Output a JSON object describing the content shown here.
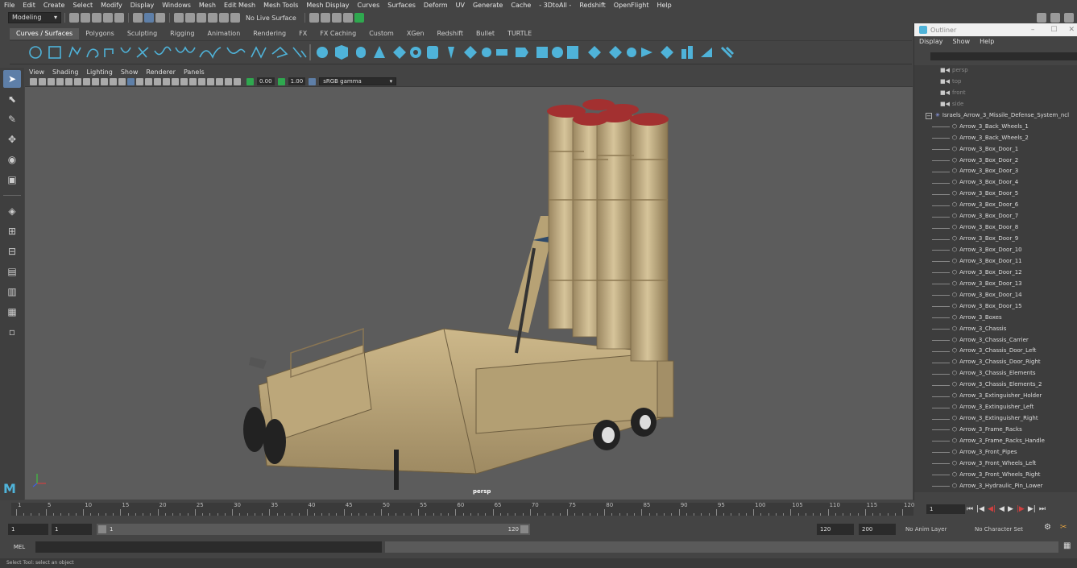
{
  "menubar": [
    "File",
    "Edit",
    "Create",
    "Select",
    "Modify",
    "Display",
    "Windows",
    "Mesh",
    "Edit Mesh",
    "Mesh Tools",
    "Mesh Display",
    "Curves",
    "Surfaces",
    "Deform",
    "UV",
    "Generate",
    "Cache",
    "- 3DtoAll -",
    "Redshift",
    "OpenFlight",
    "Help"
  ],
  "status": {
    "mode": "Modeling",
    "live_surface": "No Live Surface"
  },
  "shelf_tabs": [
    "Curves / Surfaces",
    "Polygons",
    "Sculpting",
    "Rigging",
    "Animation",
    "Rendering",
    "FX",
    "FX Caching",
    "Custom",
    "XGen",
    "Redshift",
    "Bullet",
    "TURTLE"
  ],
  "shelf_active": "Curves / Surfaces",
  "viewport": {
    "menu": [
      "View",
      "Shading",
      "Lighting",
      "Show",
      "Renderer",
      "Panels"
    ],
    "exposure": "0.00",
    "gamma": "1.00",
    "colorspace": "sRGB gamma",
    "camera": "persp"
  },
  "outliner": {
    "title": "Outliner",
    "menu": [
      "Display",
      "Show",
      "Help"
    ],
    "cameras": [
      "persp",
      "top",
      "front",
      "side"
    ],
    "root": "Israels_Arrow_3_Missile_Defense_System_ncl",
    "items": [
      "Arrow_3_Back_Wheels_1",
      "Arrow_3_Back_Wheels_2",
      "Arrow_3_Box_Door_1",
      "Arrow_3_Box_Door_2",
      "Arrow_3_Box_Door_3",
      "Arrow_3_Box_Door_4",
      "Arrow_3_Box_Door_5",
      "Arrow_3_Box_Door_6",
      "Arrow_3_Box_Door_7",
      "Arrow_3_Box_Door_8",
      "Arrow_3_Box_Door_9",
      "Arrow_3_Box_Door_10",
      "Arrow_3_Box_Door_11",
      "Arrow_3_Box_Door_12",
      "Arrow_3_Box_Door_13",
      "Arrow_3_Box_Door_14",
      "Arrow_3_Box_Door_15",
      "Arrow_3_Boxes",
      "Arrow_3_Chassis",
      "Arrow_3_Chassis_Carrier",
      "Arrow_3_Chassis_Door_Left",
      "Arrow_3_Chassis_Door_Right",
      "Arrow_3_Chassis_Elements",
      "Arrow_3_Chassis_Elements_2",
      "Arrow_3_Extinguisher_Holder",
      "Arrow_3_Extinguisher_Left",
      "Arrow_3_Extinguisher_Right",
      "Arrow_3_Frame_Racks",
      "Arrow_3_Frame_Racks_Handle",
      "Arrow_3_Front_Pipes",
      "Arrow_3_Front_Wheels_Left",
      "Arrow_3_Front_Wheels_Right",
      "Arrow_3_Hydraulic_Pin_Lower"
    ]
  },
  "timeline": {
    "ticks": [
      "1",
      "5",
      "10",
      "15",
      "20",
      "25",
      "30",
      "35",
      "40",
      "45",
      "50",
      "55",
      "60",
      "65",
      "70",
      "75",
      "80",
      "85",
      "90",
      "95",
      "100",
      "105",
      "110",
      "115",
      "120"
    ],
    "current": "1"
  },
  "range": {
    "start": "1",
    "playback_start": "1",
    "slider_start": "1",
    "slider_end": "120",
    "playback_end": "120",
    "end": "200",
    "anim_layer": "No Anim Layer",
    "character_set": "No Character Set"
  },
  "cmdline": {
    "label": "MEL"
  },
  "help": "Select Tool: select an object",
  "colors": {
    "accent": "#5e7fa8",
    "shelf_icon": "#4fb3d9",
    "missile_red": "#a33030",
    "vehicle_tan": "#c2a878"
  }
}
